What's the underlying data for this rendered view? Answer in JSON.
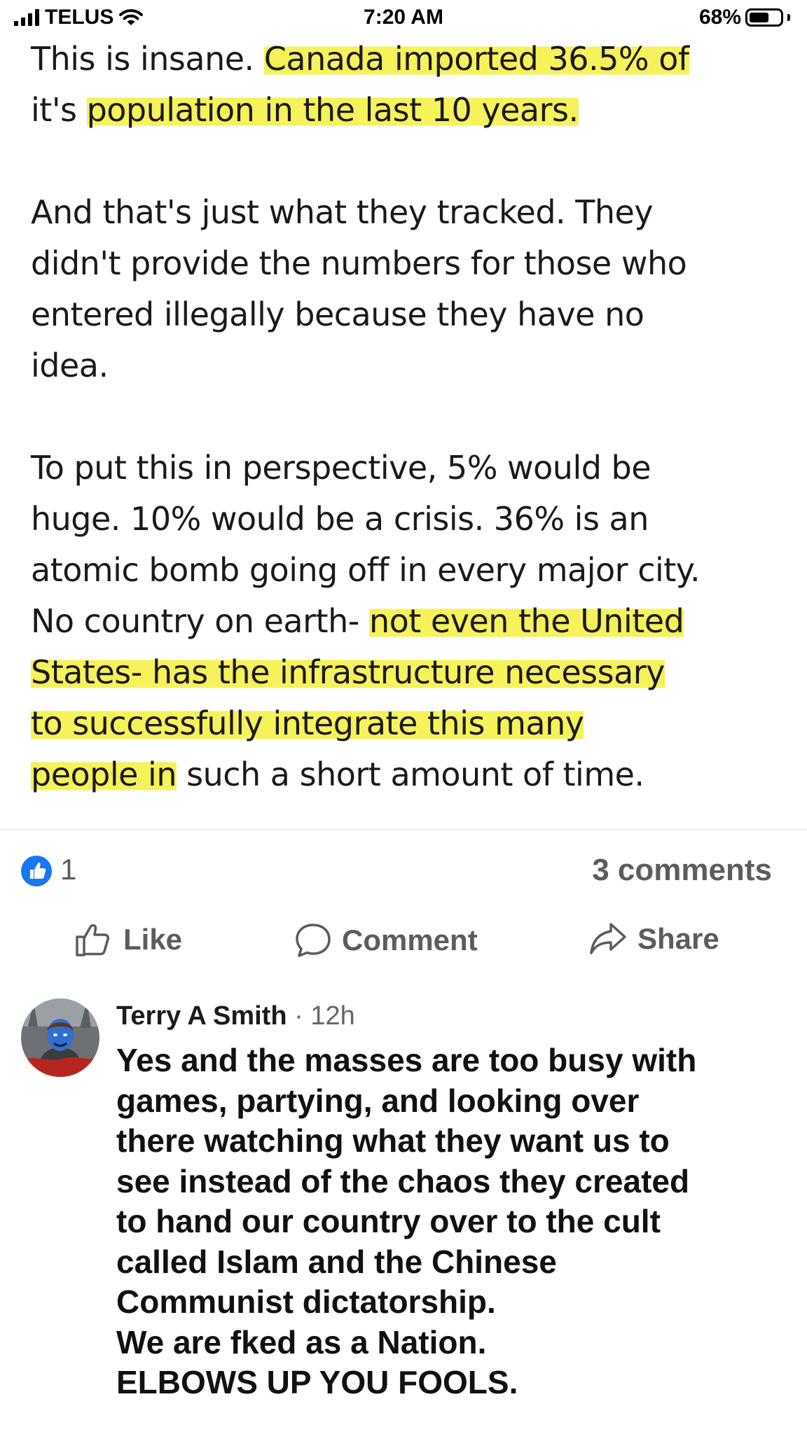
{
  "status_bar": {
    "carrier": "TELUS",
    "time": "7:20 AM",
    "battery_text": "68%",
    "battery_level": 0.68,
    "icons": [
      "signal-icon",
      "wifi-icon",
      "battery-icon"
    ]
  },
  "post": {
    "p1_plain": "This is insane. ",
    "p1_highlight_a": "Canada imported 36.5% of",
    "p1_line2_plain": "it's ",
    "p1_highlight_b": "population in the last 10 years.",
    "p2_lines": [
      "And that's just what they tracked. They",
      "didn't provide the numbers for those who",
      "entered illegally because they have no",
      "idea."
    ],
    "p3_lines": [
      "To put this in perspective, 5% would be",
      "huge. 10% would be a crisis. 36% is an",
      "atomic bomb going off in every major city."
    ],
    "p3_line4_plain": "No country on earth- ",
    "p3_line4_highlight": "not even the United",
    "p3_line5_highlight": "States- has the infrastructure necessary",
    "p3_line6_highlight": "to successfully integrate this many",
    "p3_line7_highlight": "people in",
    "p3_line7_plain": " such a short amount of time.",
    "highlight_color": "#f5f25a"
  },
  "reactions": {
    "like_count": "1",
    "comment_count": "3 comments",
    "like_badge_color": "#1877f2"
  },
  "actions": {
    "like": "Like",
    "comment": "Comment",
    "share": "Share"
  },
  "comment": {
    "author": "Terry A Smith",
    "separator": " · ",
    "time": "12h",
    "lines": [
      "Yes and the masses are too busy with",
      "games, partying, and looking over",
      "there watching what they want us to",
      "see instead of the chaos they created",
      "to hand our country over to the cult",
      "called Islam and the Chinese",
      "Communist dictatorship.",
      "We are fked as a Nation.",
      "ELBOWS UP YOU FOOLS."
    ]
  }
}
